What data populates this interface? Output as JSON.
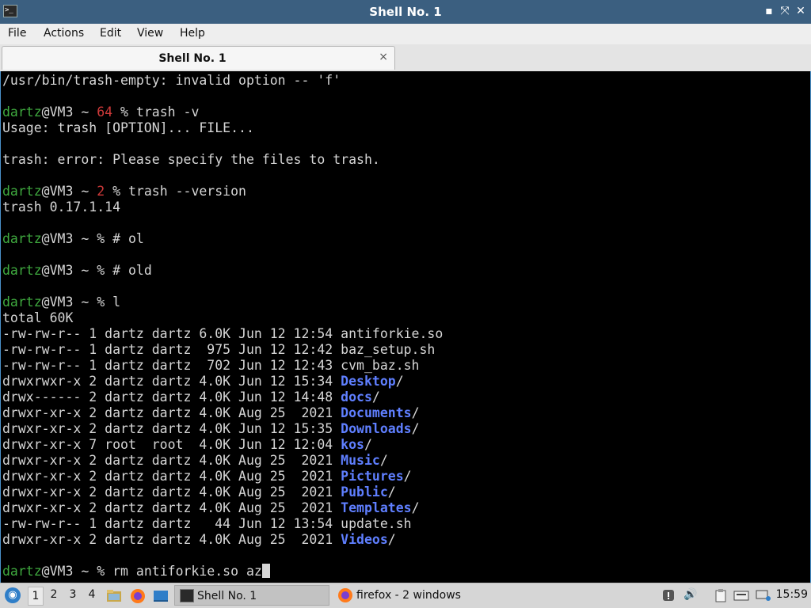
{
  "window": {
    "title": "Shell No. 1"
  },
  "menu": [
    "File",
    "Actions",
    "Edit",
    "View",
    "Help"
  ],
  "tab": {
    "label": "Shell No. 1",
    "close_glyph": "×"
  },
  "colors": {
    "prompt_user": "#3faa3f",
    "error_status": "#d03a3a",
    "directory": "#5f7fff",
    "titlebar": "#3b5f80"
  },
  "terminal": {
    "lines": [
      {
        "text": "/usr/bin/trash-empty: invalid option -- 'f'"
      },
      {
        "text": ""
      },
      {
        "prompt": true,
        "user": "dartz",
        "host": "@VM3 ~ ",
        "status": "64 ",
        "sym": "% ",
        "cmd": "trash -v"
      },
      {
        "text": "Usage: trash [OPTION]... FILE..."
      },
      {
        "text": ""
      },
      {
        "text": "trash: error: Please specify the files to trash."
      },
      {
        "text": ""
      },
      {
        "prompt": true,
        "user": "dartz",
        "host": "@VM3 ~ ",
        "status": "2 ",
        "sym": "% ",
        "cmd": "trash --version"
      },
      {
        "text": "trash 0.17.1.14"
      },
      {
        "text": ""
      },
      {
        "prompt": true,
        "user": "dartz",
        "host": "@VM3 ~ ",
        "status": "",
        "sym": "% ",
        "cmd": "# ol"
      },
      {
        "text": ""
      },
      {
        "prompt": true,
        "user": "dartz",
        "host": "@VM3 ~ ",
        "status": "",
        "sym": "% ",
        "cmd": "# old"
      },
      {
        "text": ""
      },
      {
        "prompt": true,
        "user": "dartz",
        "host": "@VM3 ~ ",
        "status": "",
        "sym": "% ",
        "cmd": "l"
      },
      {
        "text": "total 60K"
      },
      {
        "prefix": "-rw-rw-r-- 1 dartz dartz 6.0K Jun 12 12:54 ",
        "name": "antiforkie.so",
        "dir": false
      },
      {
        "prefix": "-rw-rw-r-- 1 dartz dartz  975 Jun 12 12:42 ",
        "name": "baz_setup.sh",
        "dir": false
      },
      {
        "prefix": "-rw-rw-r-- 1 dartz dartz  702 Jun 12 12:43 ",
        "name": "cvm_baz.sh",
        "dir": false
      },
      {
        "prefix": "drwxrwxr-x 2 dartz dartz 4.0K Jun 12 15:34 ",
        "name": "Desktop",
        "dir": true
      },
      {
        "prefix": "drwx------ 2 dartz dartz 4.0K Jun 12 14:48 ",
        "name": "docs",
        "dir": true
      },
      {
        "prefix": "drwxr-xr-x 2 dartz dartz 4.0K Aug 25  2021 ",
        "name": "Documents",
        "dir": true
      },
      {
        "prefix": "drwxr-xr-x 2 dartz dartz 4.0K Jun 12 15:35 ",
        "name": "Downloads",
        "dir": true
      },
      {
        "prefix": "drwxr-xr-x 7 root  root  4.0K Jun 12 12:04 ",
        "name": "kos",
        "dir": true
      },
      {
        "prefix": "drwxr-xr-x 2 dartz dartz 4.0K Aug 25  2021 ",
        "name": "Music",
        "dir": true
      },
      {
        "prefix": "drwxr-xr-x 2 dartz dartz 4.0K Aug 25  2021 ",
        "name": "Pictures",
        "dir": true
      },
      {
        "prefix": "drwxr-xr-x 2 dartz dartz 4.0K Aug 25  2021 ",
        "name": "Public",
        "dir": true
      },
      {
        "prefix": "drwxr-xr-x 2 dartz dartz 4.0K Aug 25  2021 ",
        "name": "Templates",
        "dir": true
      },
      {
        "prefix": "-rw-rw-r-- 1 dartz dartz   44 Jun 12 13:54 ",
        "name": "update.sh",
        "dir": false
      },
      {
        "prefix": "drwxr-xr-x 2 dartz dartz 4.0K Aug 25  2021 ",
        "name": "Videos",
        "dir": true
      },
      {
        "text": ""
      },
      {
        "prompt": true,
        "user": "dartz",
        "host": "@VM3 ~ ",
        "status": "",
        "sym": "% ",
        "cmd": "rm antiforkie.so az",
        "cursor": true
      }
    ]
  },
  "taskbar": {
    "workspaces": [
      "1",
      "2",
      "3",
      "4"
    ],
    "active_workspace": "1",
    "tasks": [
      {
        "label": "Shell No. 1",
        "icon": "terminal-icon"
      },
      {
        "label": "firefox - 2 windows",
        "icon": "firefox-icon"
      }
    ],
    "clock": "15:59"
  }
}
